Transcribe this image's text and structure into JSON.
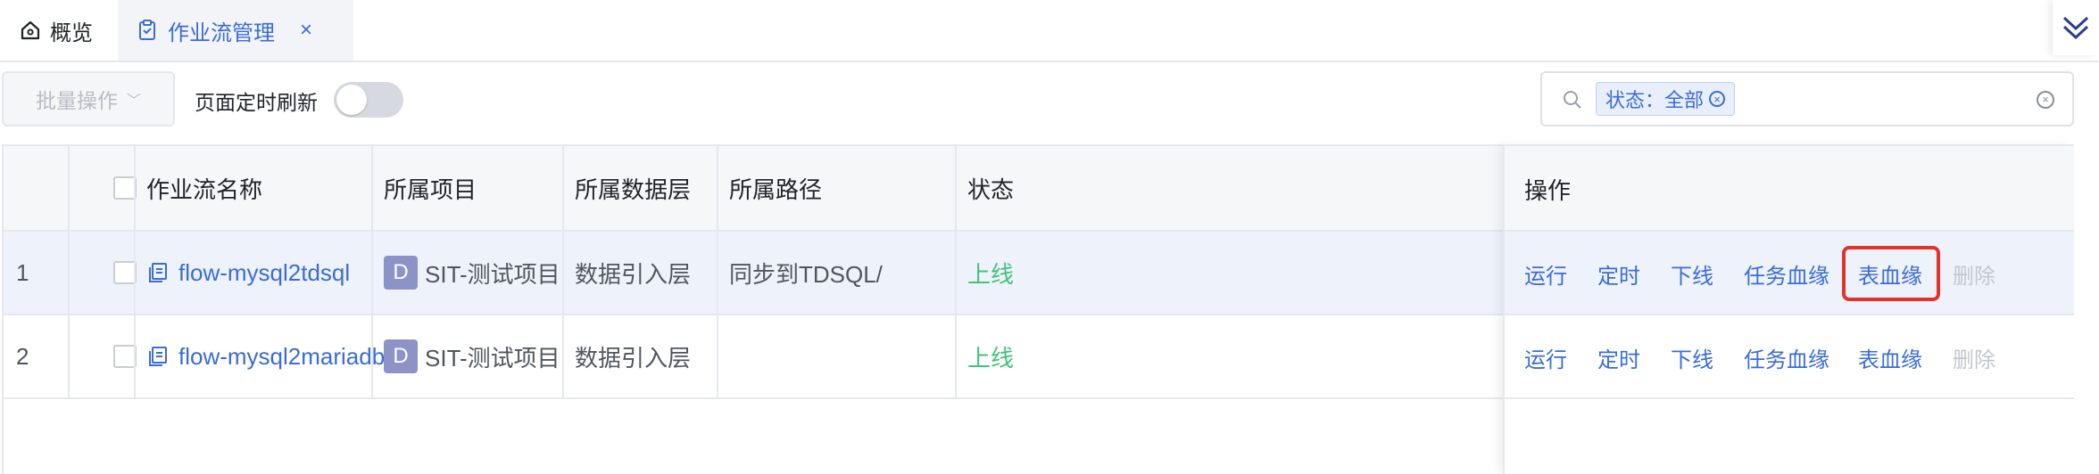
{
  "tabs": {
    "overview_label": "概览",
    "workflow_label": "作业流管理",
    "close_symbol": "×"
  },
  "toolbar": {
    "batch_label": "批量操作",
    "refresh_label": "页面定时刷新",
    "refresh_enabled": false
  },
  "search": {
    "filter_chip": "状态：全部"
  },
  "table": {
    "headers": {
      "name": "作业流名称",
      "project": "所属项目",
      "layer": "所属数据层",
      "path": "所属路径",
      "status": "状态",
      "ops": "操作"
    },
    "rows": [
      {
        "index": "1",
        "name": "flow-mysql2tdsql",
        "project_badge": "D",
        "project": "SIT-测试项目",
        "layer": "数据引入层",
        "path": "同步到TDSQL/",
        "status": "上线"
      },
      {
        "index": "2",
        "name": "flow-mysql2mariadb",
        "project_badge": "D",
        "project": "SIT-测试项目",
        "layer": "数据引入层",
        "path": "",
        "status": "上线"
      }
    ],
    "actions": {
      "run": "运行",
      "schedule": "定时",
      "offline": "下线",
      "task_lineage": "任务血缘",
      "table_lineage": "表血缘",
      "delete": "删除"
    }
  },
  "colors": {
    "accent": "#3a6cd9",
    "status_online": "#43c27a",
    "highlight": "#e0342a"
  }
}
